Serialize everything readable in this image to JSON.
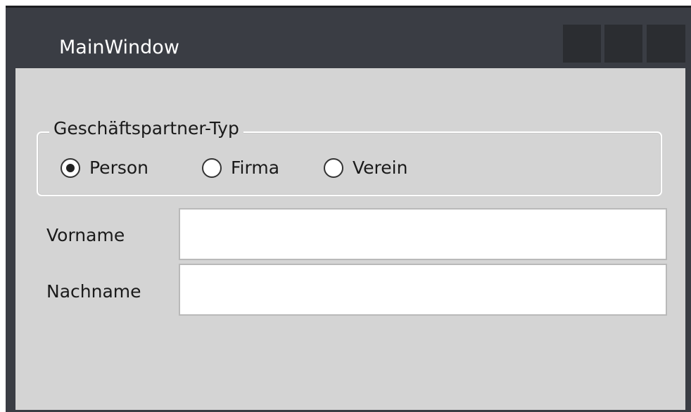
{
  "window": {
    "title": "MainWindow"
  },
  "group": {
    "legend": "Geschäftspartner-Typ",
    "options": [
      {
        "label": "Person",
        "checked": true
      },
      {
        "label": "Firma",
        "checked": false
      },
      {
        "label": "Verein",
        "checked": false
      }
    ]
  },
  "form": {
    "vorname_label": "Vorname",
    "vorname_value": "",
    "nachname_label": "Nachname",
    "nachname_value": ""
  },
  "colors": {
    "titlebar": "#3a3d44",
    "caption_buttons": "#2b2d31",
    "client_background": "#d4d4d4",
    "textbox_border": "#b9b9b9"
  },
  "icons": {
    "radio_checked": "radio-checked-icon",
    "radio_unchecked": "radio-unchecked-icon"
  }
}
